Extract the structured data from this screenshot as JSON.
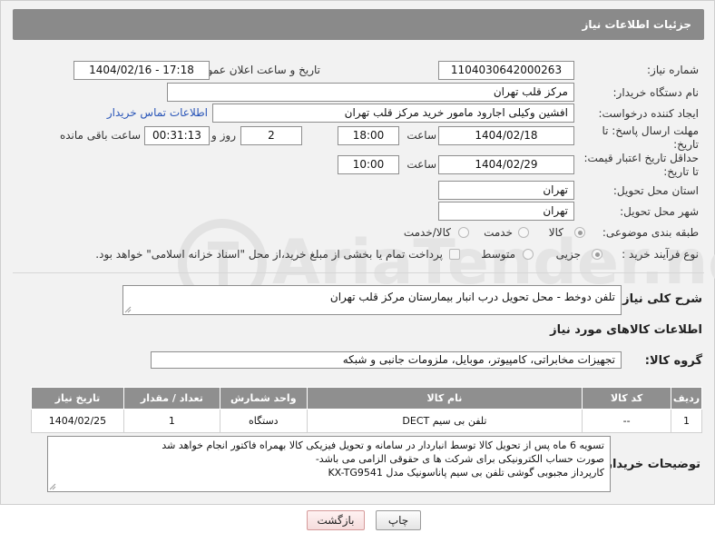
{
  "header": {
    "title": "جزئیات اطلاعات نیاز"
  },
  "fields": {
    "need_number_label": "شماره نیاز:",
    "need_number": "1104030642000263",
    "announce_label": "تاریخ و ساعت اعلان عمومی:",
    "announce_value": "1404/02/16 - 17:18",
    "buyer_org_label": "نام دستگاه خریدار:",
    "buyer_org": "مرکز قلب تهران",
    "creator_label": "ایجاد کننده درخواست:",
    "creator": "افشین وکیلی اجارود مامور خرید مرکز قلب تهران",
    "contact_link": "اطلاعات تماس خریدار",
    "deadline_label_1": "مهلت ارسال پاسخ: تا",
    "deadline_label_2": "تاریخ:",
    "deadline_date": "1404/02/18",
    "time_label": "ساعت",
    "deadline_time": "18:00",
    "days_value": "2",
    "days_label": "روز و",
    "remaining_value": "00:31:13",
    "remaining_label": "ساعت باقی مانده",
    "validity_label_1": "حداقل تاریخ اعتبار قیمت:",
    "validity_label_2": "تا تاریخ:",
    "validity_date": "1404/02/29",
    "validity_time_label": "ساعت",
    "validity_time": "10:00",
    "province_label": "استان محل تحویل:",
    "province": "تهران",
    "city_label": "شهر محل تحویل:",
    "city": "تهران",
    "category_label": "طبقه بندی موضوعی:",
    "category_options": [
      "کالا",
      "خدمت",
      "کالا/خدمت"
    ],
    "category_selected": "کالا",
    "process_label": "نوع فرآیند خرید :",
    "process_options": [
      "جزیی",
      "متوسط"
    ],
    "process_selected": "جزیی",
    "payment_note": "پرداخت تمام یا بخشی از مبلغ خرید،از محل \"اسناد خزانه اسلامی\" خواهد بود."
  },
  "description": {
    "label": "شرح کلی نیاز:",
    "text": "تلفن دوخط - محل تحویل درب انبار بیمارستان مرکز قلب تهران"
  },
  "goods": {
    "section_title": "اطلاعات کالاهای مورد نیاز",
    "group_label": "گروه کالا:",
    "group_value": "تجهیزات مخابراتی، کامپیوتر، موبایل، ملزومات جانبی و شبکه",
    "columns": [
      "ردیف",
      "کد کالا",
      "نام کالا",
      "واحد شمارش",
      "تعداد / مقدار",
      "تاریخ نیاز"
    ],
    "rows": [
      [
        "1",
        "--",
        "تلفن بی سیم DECT",
        "دستگاه",
        "1",
        "1404/02/25"
      ]
    ]
  },
  "buyer_notes": {
    "label": "توضیحات خریدار:",
    "lines": [
      "تسویه 6 ماه پس از تحویل کالا توسط انباردار در سامانه و تحویل فیزیکی کالا بهمراه فاکتور انجام خواهد شد",
      "صورت حساب الکترونیکی برای شرکت ها ی حقوقی الزامی می باشد-",
      "کارپرداز مجبوبی گوشی تلفن بی سیم پاناسونیک مدل KX-TG9541"
    ]
  },
  "buttons": {
    "print": "چاپ",
    "back": "بازگشت"
  },
  "watermark": {
    "text": "AriaTender.neT"
  },
  "colors": {
    "header": "#8a8a8a",
    "link": "#2a56b8",
    "table_header": "#8f8f8f",
    "back_button": "#f5dcdc"
  }
}
